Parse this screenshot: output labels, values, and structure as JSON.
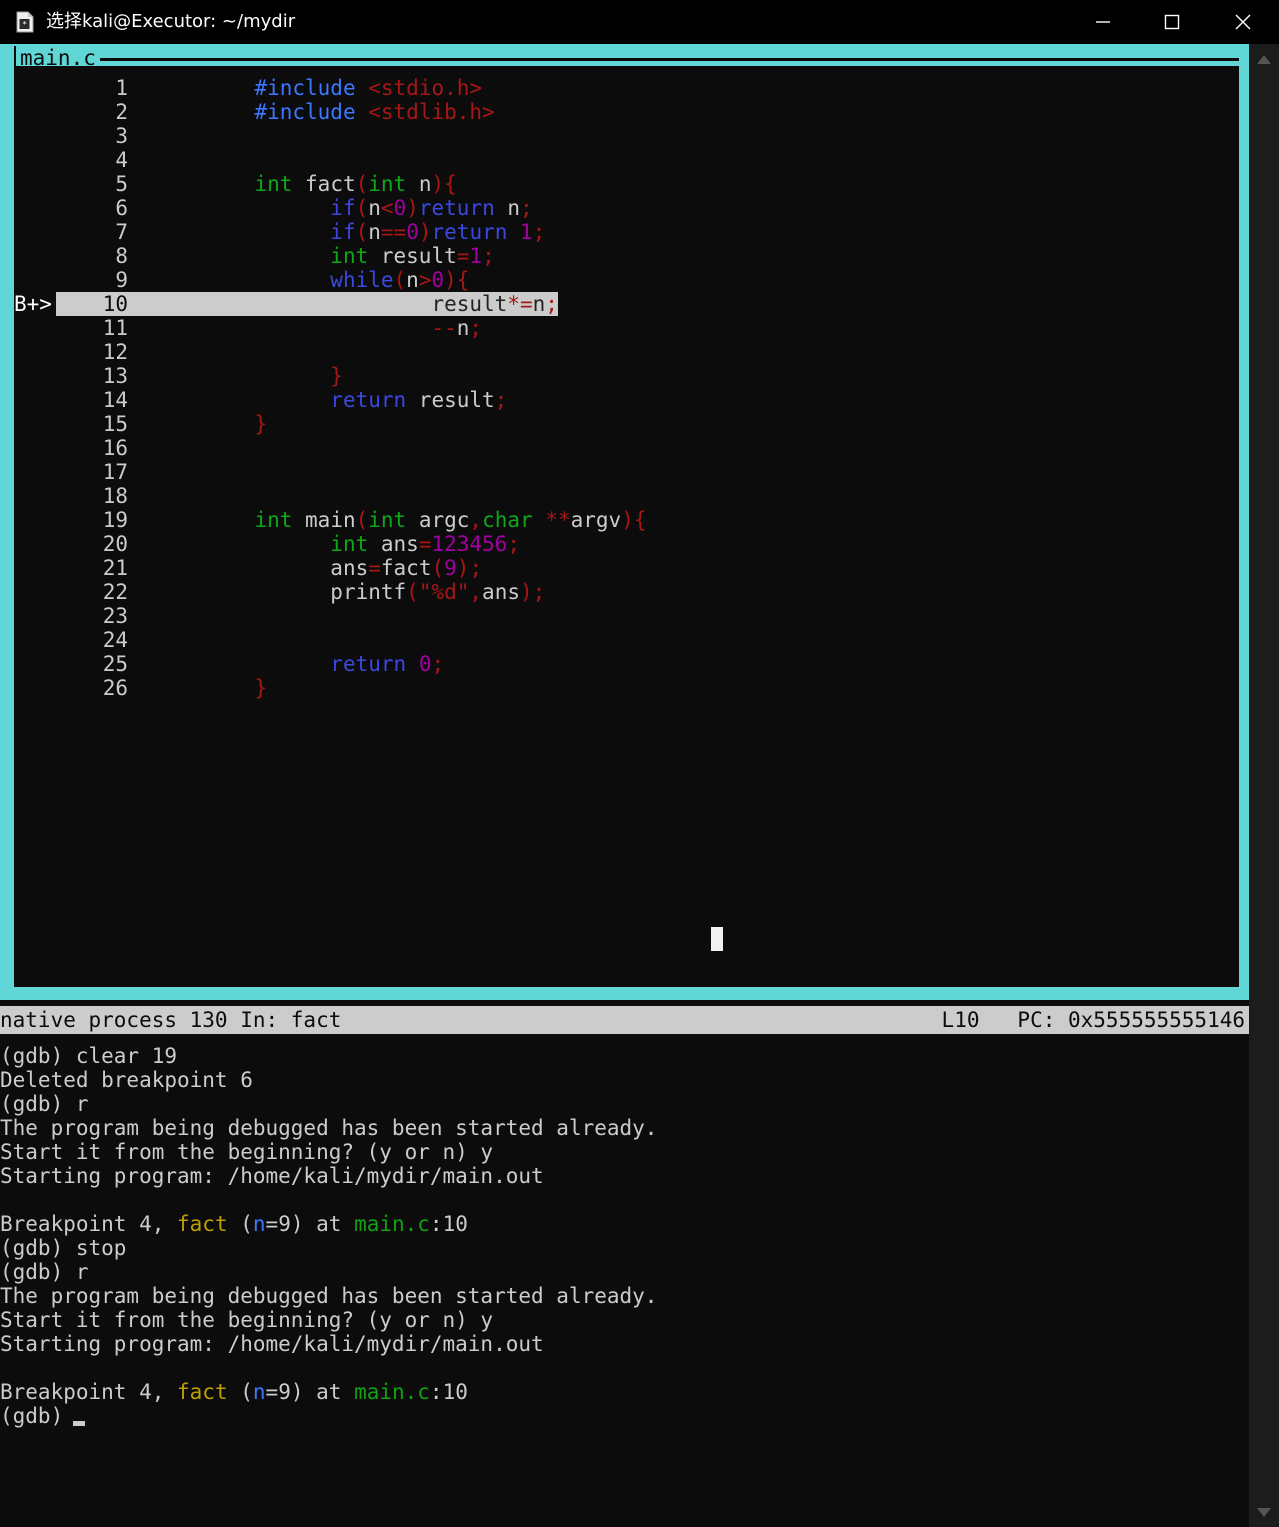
{
  "window": {
    "title": "选择kali@Executor: ~/mydir",
    "icon": "console-document-icon",
    "minimize_label": "—",
    "maximize_label": "□",
    "close_label": "✕",
    "accent_color": "#61d6d6",
    "background_color": "#0c0c0c",
    "foreground_color": "#cccccc"
  },
  "source_pane": {
    "tab_label": "main.c",
    "cursor_block": "█",
    "lines": [
      {
        "n": "1",
        "marker": "",
        "current": false,
        "tokens": [
          {
            "t": "          ",
            "c": "idn"
          },
          {
            "t": "#include",
            "c": "pre"
          },
          {
            "t": " ",
            "c": "idn"
          },
          {
            "t": "<stdio.h>",
            "c": "str"
          }
        ]
      },
      {
        "n": "2",
        "marker": "",
        "current": false,
        "tokens": [
          {
            "t": "          ",
            "c": "idn"
          },
          {
            "t": "#include",
            "c": "pre"
          },
          {
            "t": " ",
            "c": "idn"
          },
          {
            "t": "<stdlib.h>",
            "c": "str"
          }
        ]
      },
      {
        "n": "3",
        "marker": "",
        "current": false,
        "tokens": []
      },
      {
        "n": "4",
        "marker": "",
        "current": false,
        "tokens": []
      },
      {
        "n": "5",
        "marker": "",
        "current": false,
        "tokens": [
          {
            "t": "          ",
            "c": "idn"
          },
          {
            "t": "int",
            "c": "typ"
          },
          {
            "t": " ",
            "c": "idn"
          },
          {
            "t": "fact",
            "c": "idn"
          },
          {
            "t": "(",
            "c": "pun"
          },
          {
            "t": "int",
            "c": "typ"
          },
          {
            "t": " n",
            "c": "idn"
          },
          {
            "t": ")",
            "c": "pun"
          },
          {
            "t": "{",
            "c": "pun"
          }
        ]
      },
      {
        "n": "6",
        "marker": "",
        "current": false,
        "tokens": [
          {
            "t": "                ",
            "c": "idn"
          },
          {
            "t": "if",
            "c": "kw"
          },
          {
            "t": "(",
            "c": "pun"
          },
          {
            "t": "n",
            "c": "idn"
          },
          {
            "t": "<",
            "c": "pun"
          },
          {
            "t": "0",
            "c": "num"
          },
          {
            "t": ")",
            "c": "pun"
          },
          {
            "t": "return",
            "c": "kw"
          },
          {
            "t": " n",
            "c": "idn"
          },
          {
            "t": ";",
            "c": "pun"
          }
        ]
      },
      {
        "n": "7",
        "marker": "",
        "current": false,
        "tokens": [
          {
            "t": "                ",
            "c": "idn"
          },
          {
            "t": "if",
            "c": "kw"
          },
          {
            "t": "(",
            "c": "pun"
          },
          {
            "t": "n",
            "c": "idn"
          },
          {
            "t": "==",
            "c": "pun"
          },
          {
            "t": "0",
            "c": "num"
          },
          {
            "t": ")",
            "c": "pun"
          },
          {
            "t": "return",
            "c": "kw"
          },
          {
            "t": " ",
            "c": "idn"
          },
          {
            "t": "1",
            "c": "num"
          },
          {
            "t": ";",
            "c": "pun"
          }
        ]
      },
      {
        "n": "8",
        "marker": "",
        "current": false,
        "tokens": [
          {
            "t": "                ",
            "c": "idn"
          },
          {
            "t": "int",
            "c": "typ"
          },
          {
            "t": " result",
            "c": "idn"
          },
          {
            "t": "=",
            "c": "pun"
          },
          {
            "t": "1",
            "c": "num"
          },
          {
            "t": ";",
            "c": "pun"
          }
        ]
      },
      {
        "n": "9",
        "marker": "",
        "current": false,
        "tokens": [
          {
            "t": "                ",
            "c": "idn"
          },
          {
            "t": "while",
            "c": "kw"
          },
          {
            "t": "(",
            "c": "pun"
          },
          {
            "t": "n",
            "c": "idn"
          },
          {
            "t": ">",
            "c": "pun"
          },
          {
            "t": "0",
            "c": "num"
          },
          {
            "t": ")",
            "c": "pun"
          },
          {
            "t": "{",
            "c": "pun"
          }
        ]
      },
      {
        "n": "10",
        "marker": "B+>",
        "current": true,
        "tokens": [
          {
            "t": "                        ",
            "c": "idn"
          },
          {
            "t": "result",
            "c": "idn"
          },
          {
            "t": "*=",
            "c": "pun"
          },
          {
            "t": "n",
            "c": "idn"
          },
          {
            "t": ";",
            "c": "pun"
          }
        ]
      },
      {
        "n": "11",
        "marker": "",
        "current": false,
        "tokens": [
          {
            "t": "                        ",
            "c": "idn"
          },
          {
            "t": "--",
            "c": "pun"
          },
          {
            "t": "n",
            "c": "idn"
          },
          {
            "t": ";",
            "c": "pun"
          }
        ]
      },
      {
        "n": "12",
        "marker": "",
        "current": false,
        "tokens": []
      },
      {
        "n": "13",
        "marker": "",
        "current": false,
        "tokens": [
          {
            "t": "                ",
            "c": "idn"
          },
          {
            "t": "}",
            "c": "pun"
          }
        ]
      },
      {
        "n": "14",
        "marker": "",
        "current": false,
        "tokens": [
          {
            "t": "                ",
            "c": "idn"
          },
          {
            "t": "return",
            "c": "kw"
          },
          {
            "t": " result",
            "c": "idn"
          },
          {
            "t": ";",
            "c": "pun"
          }
        ]
      },
      {
        "n": "15",
        "marker": "",
        "current": false,
        "tokens": [
          {
            "t": "          ",
            "c": "idn"
          },
          {
            "t": "}",
            "c": "pun"
          }
        ]
      },
      {
        "n": "16",
        "marker": "",
        "current": false,
        "tokens": []
      },
      {
        "n": "17",
        "marker": "",
        "current": false,
        "tokens": []
      },
      {
        "n": "18",
        "marker": "",
        "current": false,
        "tokens": []
      },
      {
        "n": "19",
        "marker": "",
        "current": false,
        "tokens": [
          {
            "t": "          ",
            "c": "idn"
          },
          {
            "t": "int",
            "c": "typ"
          },
          {
            "t": " ",
            "c": "idn"
          },
          {
            "t": "main",
            "c": "idn"
          },
          {
            "t": "(",
            "c": "pun"
          },
          {
            "t": "int",
            "c": "typ"
          },
          {
            "t": " argc",
            "c": "idn"
          },
          {
            "t": ",",
            "c": "pun"
          },
          {
            "t": "char",
            "c": "typ"
          },
          {
            "t": " ",
            "c": "idn"
          },
          {
            "t": "**",
            "c": "pun"
          },
          {
            "t": "argv",
            "c": "idn"
          },
          {
            "t": ")",
            "c": "pun"
          },
          {
            "t": "{",
            "c": "pun"
          }
        ]
      },
      {
        "n": "20",
        "marker": "",
        "current": false,
        "tokens": [
          {
            "t": "                ",
            "c": "idn"
          },
          {
            "t": "int",
            "c": "typ"
          },
          {
            "t": " ans",
            "c": "idn"
          },
          {
            "t": "=",
            "c": "pun"
          },
          {
            "t": "123456",
            "c": "num"
          },
          {
            "t": ";",
            "c": "pun"
          }
        ]
      },
      {
        "n": "21",
        "marker": "",
        "current": false,
        "tokens": [
          {
            "t": "                ",
            "c": "idn"
          },
          {
            "t": "ans",
            "c": "idn"
          },
          {
            "t": "=",
            "c": "pun"
          },
          {
            "t": "fact",
            "c": "idn"
          },
          {
            "t": "(",
            "c": "pun"
          },
          {
            "t": "9",
            "c": "num"
          },
          {
            "t": ")",
            "c": "pun"
          },
          {
            "t": ";",
            "c": "pun"
          }
        ]
      },
      {
        "n": "22",
        "marker": "",
        "current": false,
        "tokens": [
          {
            "t": "                ",
            "c": "idn"
          },
          {
            "t": "printf",
            "c": "idn"
          },
          {
            "t": "(",
            "c": "pun"
          },
          {
            "t": "\"%d\"",
            "c": "str"
          },
          {
            "t": ",",
            "c": "pun"
          },
          {
            "t": "ans",
            "c": "idn"
          },
          {
            "t": ")",
            "c": "pun"
          },
          {
            "t": ";",
            "c": "pun"
          }
        ]
      },
      {
        "n": "23",
        "marker": "",
        "current": false,
        "tokens": []
      },
      {
        "n": "24",
        "marker": "",
        "current": false,
        "tokens": []
      },
      {
        "n": "25",
        "marker": "",
        "current": false,
        "tokens": [
          {
            "t": "                ",
            "c": "idn"
          },
          {
            "t": "return",
            "c": "kw"
          },
          {
            "t": " ",
            "c": "idn"
          },
          {
            "t": "0",
            "c": "num"
          },
          {
            "t": ";",
            "c": "pun"
          }
        ]
      },
      {
        "n": "26",
        "marker": "",
        "current": false,
        "tokens": [
          {
            "t": "          ",
            "c": "idn"
          },
          {
            "t": "}",
            "c": "pun"
          }
        ]
      }
    ]
  },
  "status_bar": {
    "left": "native process 130 In: fact",
    "line": "L10",
    "pc": "PC: 0x555555555146"
  },
  "console": {
    "lines": [
      {
        "tokens": [
          {
            "t": "(gdb) clear 19",
            "c": "o-white"
          }
        ]
      },
      {
        "tokens": [
          {
            "t": "Deleted breakpoint 6 ",
            "c": "o-white"
          }
        ]
      },
      {
        "tokens": [
          {
            "t": "(gdb) r",
            "c": "o-white"
          }
        ]
      },
      {
        "tokens": [
          {
            "t": "The program being debugged has been started already.",
            "c": "o-white"
          }
        ]
      },
      {
        "tokens": [
          {
            "t": "Start it from the beginning? (y or n) y",
            "c": "o-white"
          }
        ]
      },
      {
        "tokens": [
          {
            "t": "Starting program: /home/kali/mydir/main.out ",
            "c": "o-white"
          }
        ]
      },
      {
        "tokens": []
      },
      {
        "tokens": [
          {
            "t": "Breakpoint 4, ",
            "c": "o-white"
          },
          {
            "t": "fact",
            "c": "o-func"
          },
          {
            "t": " (",
            "c": "o-white"
          },
          {
            "t": "n",
            "c": "o-var"
          },
          {
            "t": "=9) at ",
            "c": "o-white"
          },
          {
            "t": "main.c",
            "c": "o-file"
          },
          {
            "t": ":10",
            "c": "o-white"
          }
        ]
      },
      {
        "tokens": [
          {
            "t": "(gdb) stop",
            "c": "o-white"
          }
        ]
      },
      {
        "tokens": [
          {
            "t": "(gdb) r",
            "c": "o-white"
          }
        ]
      },
      {
        "tokens": [
          {
            "t": "The program being debugged has been started already.",
            "c": "o-white"
          }
        ]
      },
      {
        "tokens": [
          {
            "t": "Start it from the beginning? (y or n) y",
            "c": "o-white"
          }
        ]
      },
      {
        "tokens": [
          {
            "t": "Starting program: /home/kali/mydir/main.out ",
            "c": "o-white"
          }
        ]
      },
      {
        "tokens": []
      },
      {
        "tokens": [
          {
            "t": "Breakpoint 4, ",
            "c": "o-white"
          },
          {
            "t": "fact",
            "c": "o-func"
          },
          {
            "t": " (",
            "c": "o-white"
          },
          {
            "t": "n",
            "c": "o-var"
          },
          {
            "t": "=9) at ",
            "c": "o-white"
          },
          {
            "t": "main.c",
            "c": "o-file"
          },
          {
            "t": ":10",
            "c": "o-white"
          }
        ]
      },
      {
        "tokens": [
          {
            "t": "(gdb) ",
            "c": "o-white"
          }
        ]
      }
    ]
  },
  "scrollbar": {
    "up_arrow": "▲",
    "down_arrow": "▼"
  }
}
